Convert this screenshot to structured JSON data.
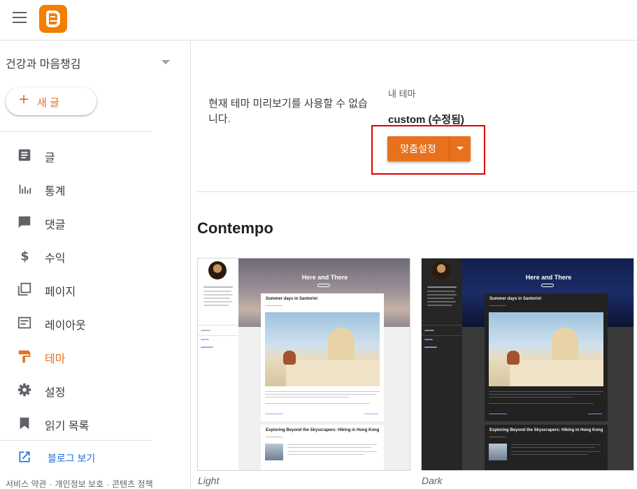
{
  "sidebar": {
    "blog_name": "건강과 마음챙김",
    "new_post_icon": "+",
    "new_post_label": "새 글",
    "nav": [
      {
        "label": "글",
        "icon": "posts-icon"
      },
      {
        "label": "통계",
        "icon": "stats-icon"
      },
      {
        "label": "댓글",
        "icon": "comments-icon"
      },
      {
        "label": "수익",
        "icon": "earnings-icon"
      },
      {
        "label": "페이지",
        "icon": "pages-icon"
      },
      {
        "label": "레이아웃",
        "icon": "layout-icon"
      },
      {
        "label": "테마",
        "icon": "theme-roller-icon",
        "active": true
      },
      {
        "label": "설정",
        "icon": "gear-icon"
      },
      {
        "label": "읽기 목록",
        "icon": "bookmark-icon"
      }
    ],
    "view_blog_label": "블로그 보기",
    "footer_links": [
      "서비스 약관",
      "개인정보 보호",
      "콘텐츠 정책"
    ]
  },
  "main": {
    "no_preview_text": "현재 테마 미리보기를 사용할 수 없습니다.",
    "my_theme_label": "내 테마",
    "current_theme": "custom (수정됨)",
    "customize_label": "맞춤설정",
    "section_title": "Contempo",
    "themes": [
      {
        "caption": "Light",
        "header_title": "Here and There",
        "post_title": "Summer days in Santorini",
        "post2_title": "Exploring Beyond the Skyscrapers: Hiking in Hong Kong"
      },
      {
        "caption": "Dark",
        "header_title": "Here and There",
        "post_title": "Summer days in Santorini",
        "post2_title": "Exploring Beyond the Skyscrapers: Hiking in Hong Kong"
      }
    ]
  },
  "colors": {
    "accent": "#e8711e",
    "brand": "#f57d00",
    "highlight_border": "#e00000",
    "link": "#1e6dd8"
  }
}
